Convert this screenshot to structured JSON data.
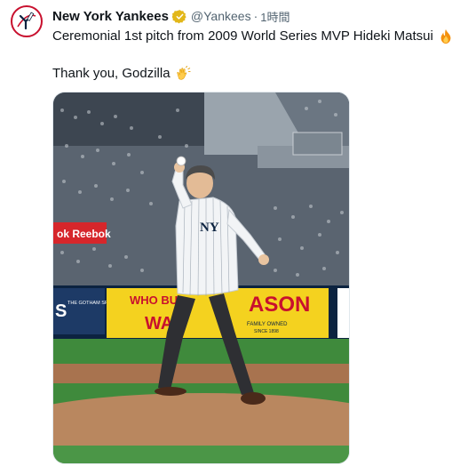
{
  "tweet": {
    "author_name": "New York Yankees",
    "handle": "@Yankees",
    "separator": "·",
    "timestamp": "1時間",
    "text_line1": "Ceremonial 1st pitch from 2009 World Series MVP Hideki Matsui",
    "text_line2": "Thank you, Godzilla",
    "emoji1": "fire-emoji",
    "emoji2": "clapping-hands-emoji"
  },
  "media": {
    "ad_reebok": "ok Reebok",
    "ad_gotham": "THE GOTHAM SPORTS APP",
    "ad_gotham_s": "S",
    "ad_mason_who": "WHO BU",
    "ad_mason_word": "ASON",
    "ad_mason_w": "WA",
    "ad_mason_family": "FAMILY OWNED",
    "ad_mason_since": "SINCE 1898"
  },
  "colors": {
    "yankees_navy": "#0c2340",
    "yankees_red": "#c8102e",
    "verified_gold": "#e2b719",
    "field_green": "#3f8a3c",
    "dirt": "#b9875f"
  }
}
